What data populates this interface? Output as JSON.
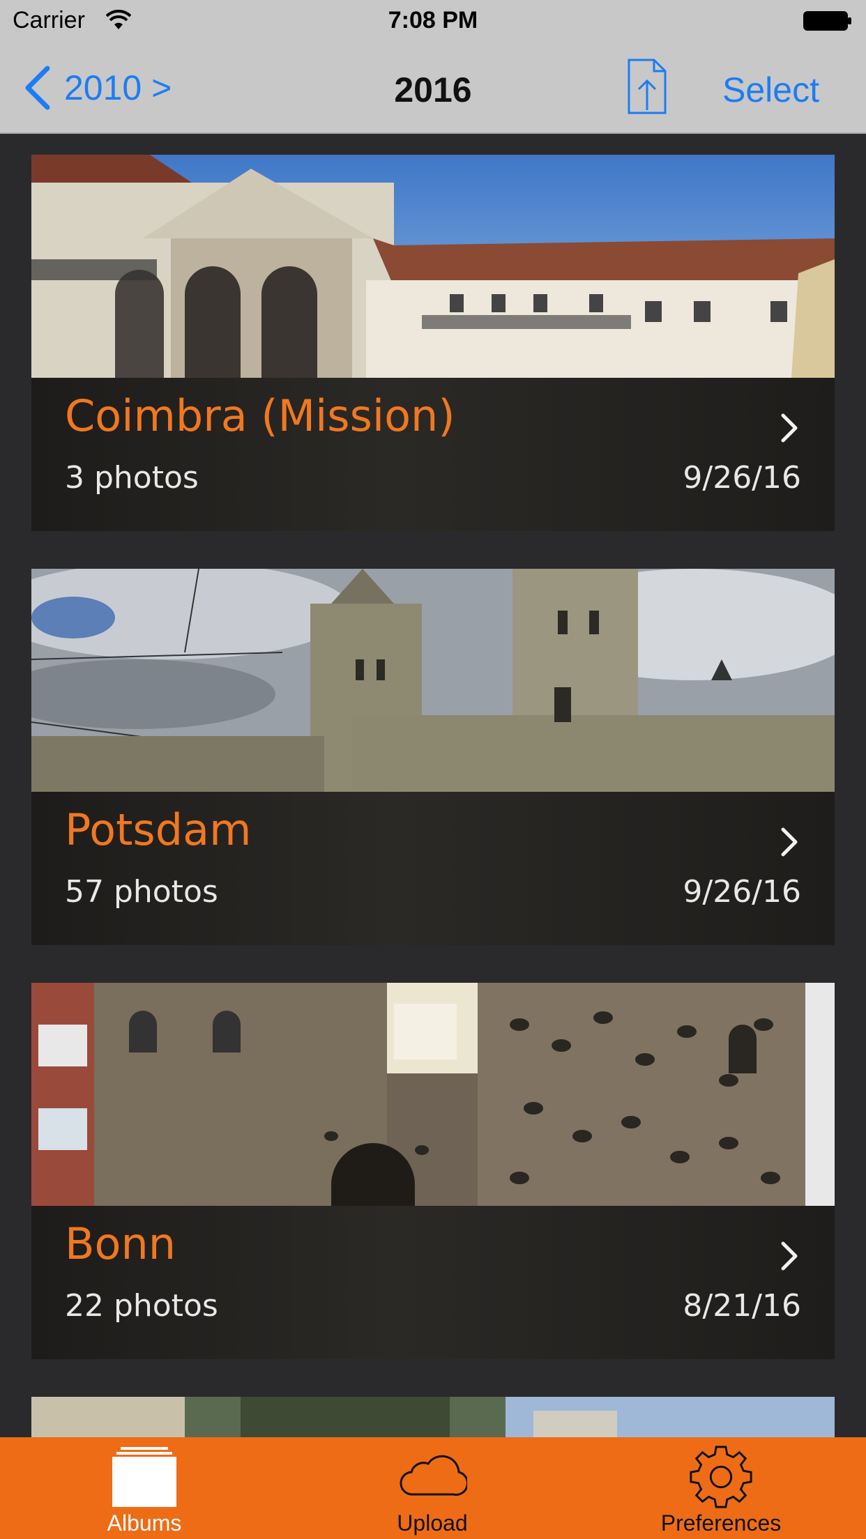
{
  "status_bar": {
    "carrier": "Carrier",
    "time": "7:08 PM"
  },
  "nav": {
    "back_label": "2010 >",
    "title": "2016",
    "select_label": "Select"
  },
  "albums": [
    {
      "title": "Coimbra (Mission)",
      "count": "3 photos",
      "date": "9/26/16"
    },
    {
      "title": "Potsdam",
      "count": "57 photos",
      "date": "9/26/16"
    },
    {
      "title": "Bonn",
      "count": "22 photos",
      "date": "8/21/16"
    }
  ],
  "tabs": [
    {
      "label": "Albums",
      "icon": "albums-icon",
      "selected": true
    },
    {
      "label": "Upload",
      "icon": "cloud-icon",
      "selected": false
    },
    {
      "label": "Preferences",
      "icon": "gear-icon",
      "selected": false
    }
  ],
  "colors": {
    "accent": "#1e7cf2",
    "brand": "#ee6c16",
    "album_title": "#f07820"
  }
}
